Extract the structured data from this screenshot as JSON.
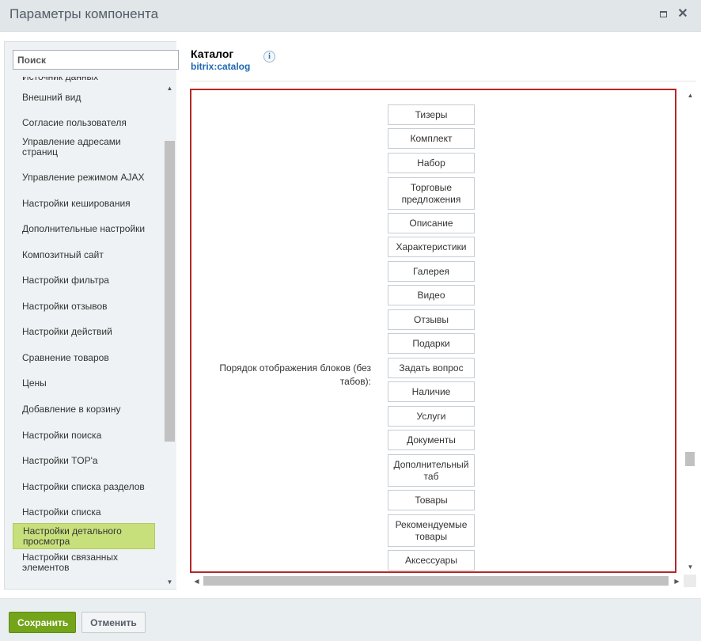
{
  "window": {
    "title": "Параметры компонента"
  },
  "search": {
    "placeholder": "Поиск"
  },
  "sidebar": {
    "items": [
      {
        "label": "Источник данных"
      },
      {
        "label": "Внешний вид"
      },
      {
        "label": "Согласие пользователя"
      },
      {
        "label": "Управление адресами страниц"
      },
      {
        "label": "Управление режимом AJAX"
      },
      {
        "label": "Настройки кеширования"
      },
      {
        "label": "Дополнительные настройки"
      },
      {
        "label": "Композитный сайт"
      },
      {
        "label": "Настройки фильтра"
      },
      {
        "label": "Настройки отзывов"
      },
      {
        "label": "Настройки действий"
      },
      {
        "label": "Сравнение товаров"
      },
      {
        "label": "Цены"
      },
      {
        "label": "Добавление в корзину"
      },
      {
        "label": "Настройки поиска"
      },
      {
        "label": "Настройки TOP'а"
      },
      {
        "label": "Настройки списка разделов"
      },
      {
        "label": "Настройки списка"
      },
      {
        "label": "Настройки детального просмотра",
        "active": true
      },
      {
        "label": "Настройки связанных элементов"
      }
    ]
  },
  "component": {
    "name": "Каталог",
    "id": "bitrix:catalog",
    "info_icon": "info-icon"
  },
  "property": {
    "label": "Порядок отображения блоков (без табов):",
    "blocks": [
      "Тизеры",
      "Комплект",
      "Набор",
      "Торговые предложения",
      "Описание",
      "Характеристики",
      "Галерея",
      "Видео",
      "Отзывы",
      "Подарки",
      "Задать вопрос",
      "Наличие",
      "Услуги",
      "Документы",
      "Дополнительный таб",
      "Товары",
      "Рекомендуемые товары",
      "Аксессуары"
    ]
  },
  "footer": {
    "save_label": "Сохранить",
    "cancel_label": "Отменить"
  },
  "colors": {
    "accent_active": "#c8e07c",
    "save_button": "#74a41a",
    "highlight_border": "#b72626",
    "link": "#1f67b0"
  }
}
